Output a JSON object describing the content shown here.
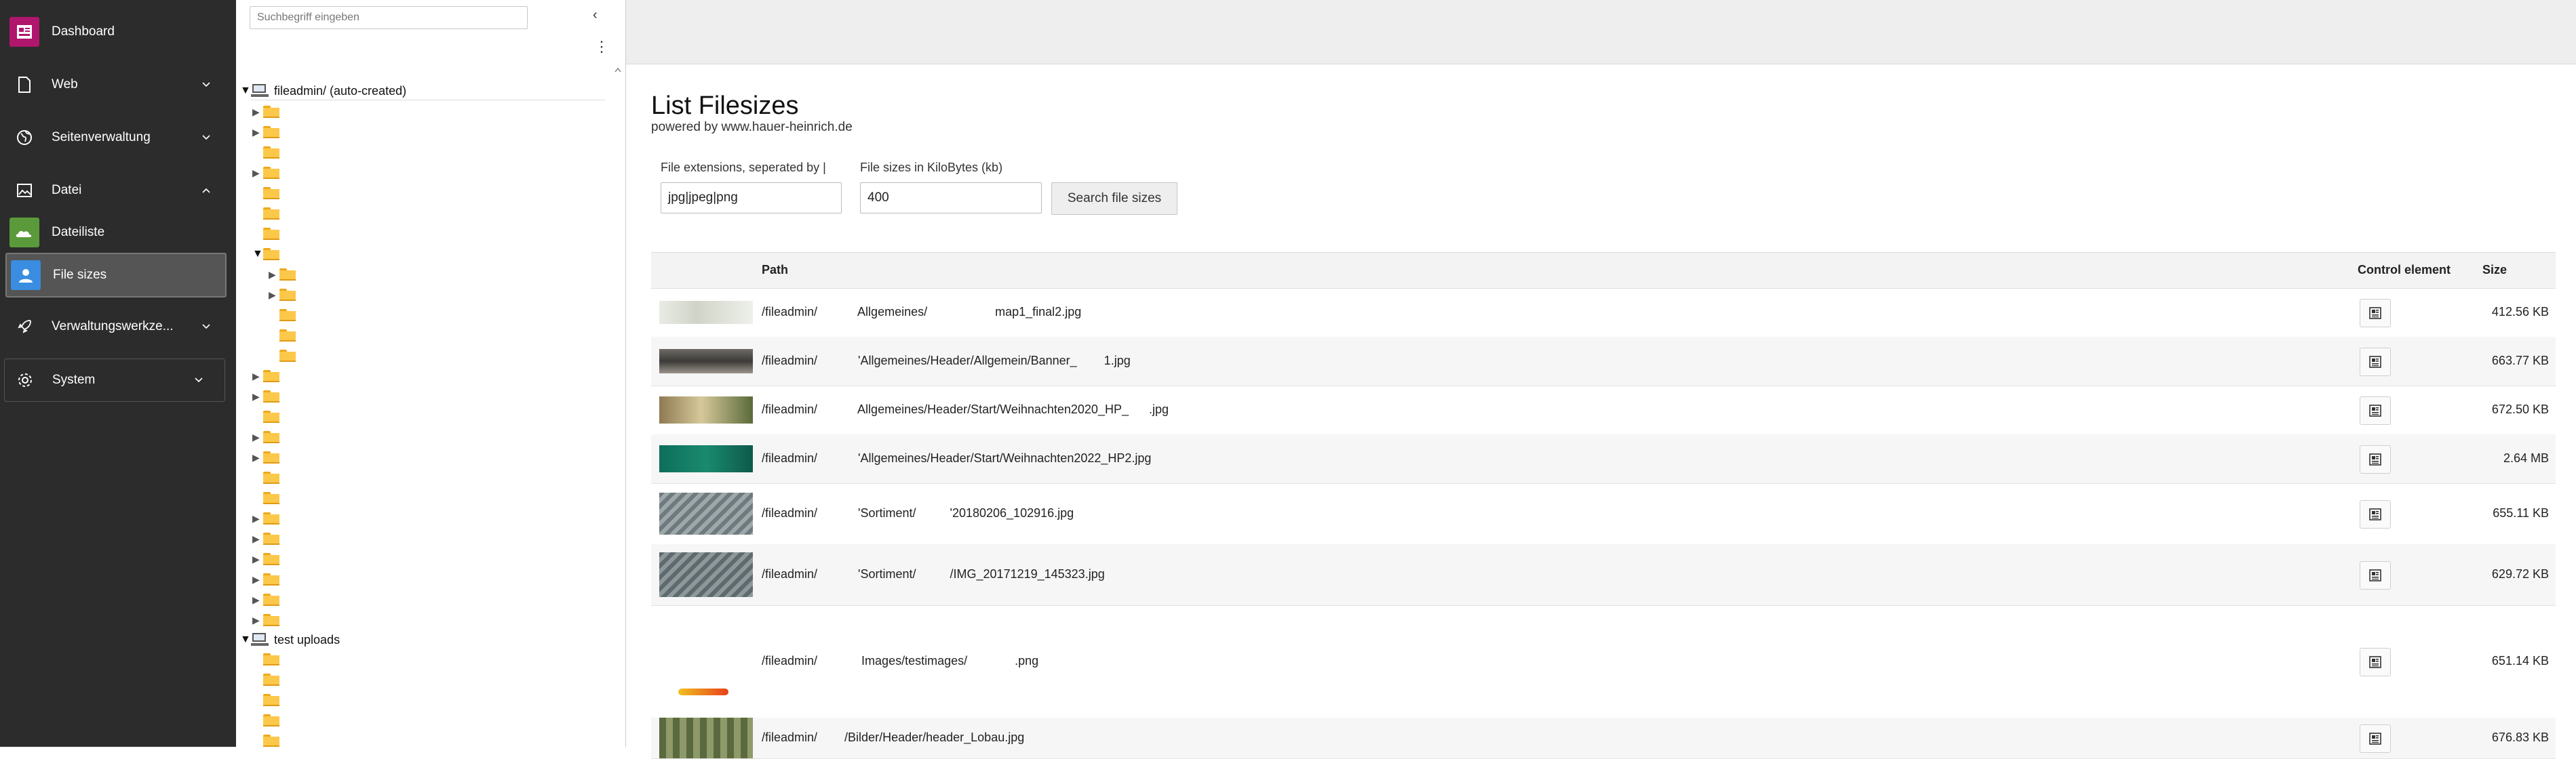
{
  "sidebar": {
    "items": [
      {
        "label": "Dashboard"
      },
      {
        "label": "Web"
      },
      {
        "label": "Seitenverwaltung"
      },
      {
        "label": "Datei"
      },
      {
        "label": "Dateiliste"
      },
      {
        "label": "File sizes"
      },
      {
        "label": "Verwaltungswerkze..."
      },
      {
        "label": "System"
      }
    ]
  },
  "tree": {
    "search_placeholder": "Suchbegriff eingeben",
    "root1_label": "fileadmin/ (auto-created)",
    "root2_label": "test uploads"
  },
  "main": {
    "title": "List Filesizes",
    "subtitle": "powered by www.hauer-heinrich.de",
    "ext_label": "File extensions, seperated by |",
    "ext_value": "jpg|jpeg|png",
    "size_label": "File sizes in KiloBytes (kb)",
    "size_value": "400",
    "search_button": "Search file sizes"
  },
  "table": {
    "headers": {
      "path": "Path",
      "control": "Control element",
      "size": "Size"
    },
    "rows": [
      {
        "path": "/fileadmin/            Allgemeines/                    map1_final2.jpg",
        "size": "412.56 KB"
      },
      {
        "path": "/fileadmin/            'Allgemeines/Header/Allgemein/Banner_        1.jpg",
        "size": "663.77 KB"
      },
      {
        "path": "/fileadmin/            Allgemeines/Header/Start/Weihnachten2020_HP_      .jpg",
        "size": "672.50 KB"
      },
      {
        "path": "/fileadmin/            'Allgemeines/Header/Start/Weihnachten2022_HP2.jpg",
        "size": "2.64 MB"
      },
      {
        "path": "/fileadmin/            'Sortiment/          '20180206_102916.jpg",
        "size": "655.11 KB"
      },
      {
        "path": "/fileadmin/            'Sortiment/          /IMG_20171219_145323.jpg",
        "size": "629.72 KB"
      },
      {
        "path": "/fileadmin/             Images/testimages/              .png",
        "size": "651.14 KB"
      },
      {
        "path": "/fileadmin/        /Bilder/Header/header_Lobau.jpg",
        "size": "676.83 KB"
      }
    ]
  }
}
